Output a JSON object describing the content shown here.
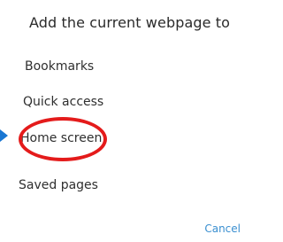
{
  "dialog": {
    "title": "Add the current webpage to",
    "options": [
      {
        "label": "Bookmarks"
      },
      {
        "label": "Quick access"
      },
      {
        "label": "Home screen"
      },
      {
        "label": "Saved pages"
      }
    ],
    "cancel_label": "Cancel"
  },
  "annotation": {
    "highlight_color": "#e41b1b",
    "arrow_color": "#1976d2",
    "highlighted_option": "Home screen"
  },
  "colors": {
    "background": "#ffffff",
    "text": "#2b2b2b",
    "accent": "#3a8fd0"
  }
}
